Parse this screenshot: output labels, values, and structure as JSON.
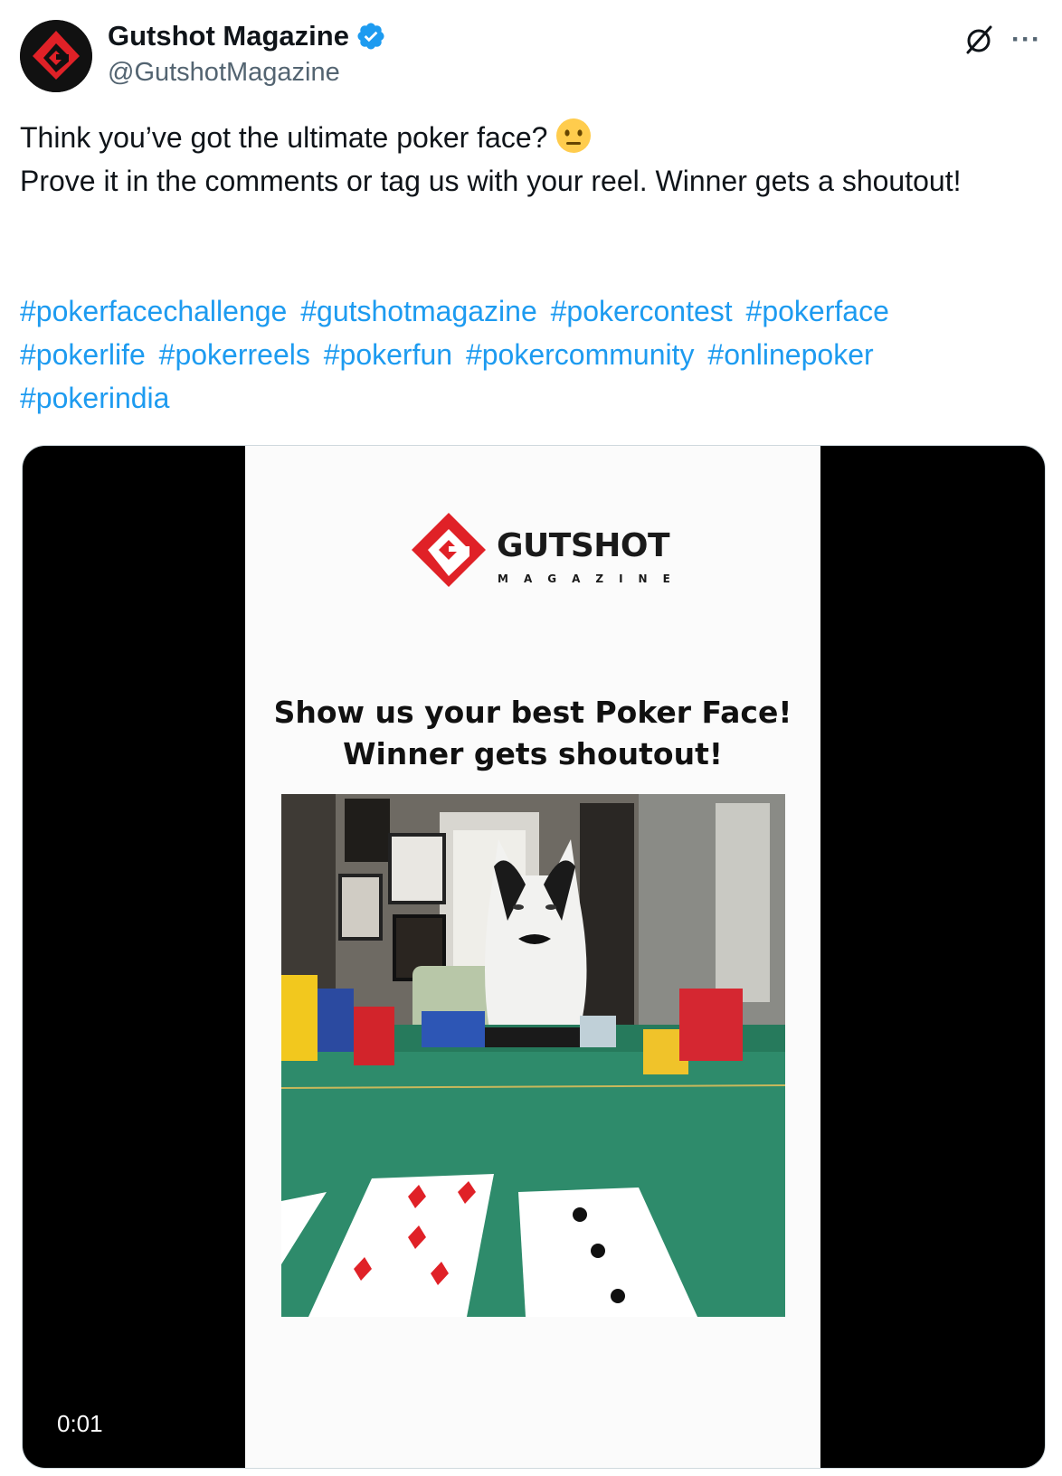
{
  "tweet": {
    "author": {
      "display_name": "Gutshot Magazine",
      "handle": "@GutshotMagazine",
      "verified": true
    },
    "text_line1": "Think you’ve got the ultimate poker face?",
    "text_line2": "Prove it in the comments or tag us with your reel. Winner gets a shoutout!",
    "hashtags": [
      "#pokerfacechallenge",
      "#gutshotmagazine",
      "#pokercontest",
      "#pokerface",
      "#pokerlife",
      "#pokerreels",
      "#pokerfun",
      "#pokercommunity",
      "#onlinepoker",
      "#pokerindia"
    ]
  },
  "media": {
    "logo_text": "GUTSHOT",
    "logo_subtext": "MAGAZINE",
    "headline_line1": "Show us your best Poker Face!",
    "headline_line2": "Winner gets shoutout!",
    "timestamp": "0:01"
  },
  "icons": {
    "verified": "verified-badge-icon",
    "grok": "grok-icon",
    "more": "more-options-icon",
    "emoji": "neutral-face-emoji"
  },
  "colors": {
    "link": "#1d9bf0",
    "text": "#0f1419",
    "secondary": "#536471",
    "brand_red": "#e02127"
  }
}
